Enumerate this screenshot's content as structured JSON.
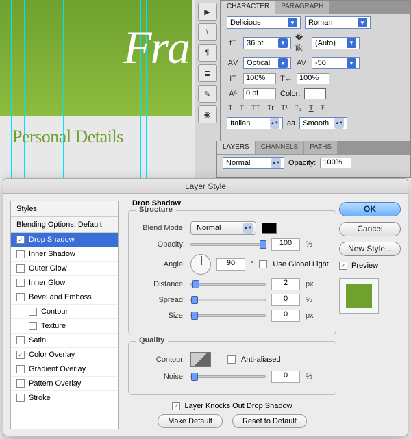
{
  "canvas": {
    "big_text": "Fra",
    "sub_text": "Personal Details"
  },
  "char_panel": {
    "tabs": {
      "character": "CHARACTER",
      "paragraph": "PARAGRAPH"
    },
    "font_family": "Delicious",
    "font_style": "Roman",
    "font_size": "36 pt",
    "leading": "(Auto)",
    "kerning": "Optical",
    "tracking": "-50",
    "vscale": "100%",
    "hscale": "100%",
    "baseline": "0 pt",
    "color_label": "Color:",
    "lang": "Italian",
    "aa_label": "aa",
    "aa_value": "Smooth",
    "style_buttons": [
      "T",
      "T",
      "TT",
      "Tr",
      "T¹",
      "T₁",
      "T",
      "Ŧ"
    ]
  },
  "layers_panel": {
    "tabs": {
      "layers": "LAYERS",
      "channels": "CHANNELS",
      "paths": "PATHS"
    },
    "mode": "Normal",
    "opacity_label": "Opacity:",
    "opacity_value": "100%"
  },
  "dialog": {
    "title": "Layer Style",
    "styles_header": "Styles",
    "blending_options": "Blending Options: Default",
    "items": [
      {
        "label": "Drop Shadow",
        "checked": true,
        "active": true
      },
      {
        "label": "Inner Shadow",
        "checked": false
      },
      {
        "label": "Outer Glow",
        "checked": false
      },
      {
        "label": "Inner Glow",
        "checked": false
      },
      {
        "label": "Bevel and Emboss",
        "checked": false
      },
      {
        "label": "Contour",
        "checked": false,
        "sub": true
      },
      {
        "label": "Texture",
        "checked": false,
        "sub": true
      },
      {
        "label": "Satin",
        "checked": false
      },
      {
        "label": "Color Overlay",
        "checked": true
      },
      {
        "label": "Gradient Overlay",
        "checked": false
      },
      {
        "label": "Pattern Overlay",
        "checked": false
      },
      {
        "label": "Stroke",
        "checked": false
      }
    ],
    "section_title": "Drop Shadow",
    "structure_title": "Structure",
    "blend_mode_label": "Blend Mode:",
    "blend_mode_value": "Normal",
    "opacity_label": "Opacity:",
    "opacity_value": "100",
    "opacity_unit": "%",
    "angle_label": "Angle:",
    "angle_value": "90",
    "angle_unit": "°",
    "use_global": "Use Global Light",
    "distance_label": "Distance:",
    "distance_value": "2",
    "distance_unit": "px",
    "spread_label": "Spread:",
    "spread_value": "0",
    "spread_unit": "%",
    "size_label": "Size:",
    "size_value": "0",
    "size_unit": "px",
    "quality_title": "Quality",
    "contour_label": "Contour:",
    "anti_aliased": "Anti-aliased",
    "noise_label": "Noise:",
    "noise_value": "0",
    "noise_unit": "%",
    "knocks_out": "Layer Knocks Out Drop Shadow",
    "make_default": "Make Default",
    "reset_default": "Reset to Default",
    "ok": "OK",
    "cancel": "Cancel",
    "new_style": "New Style...",
    "preview": "Preview"
  }
}
